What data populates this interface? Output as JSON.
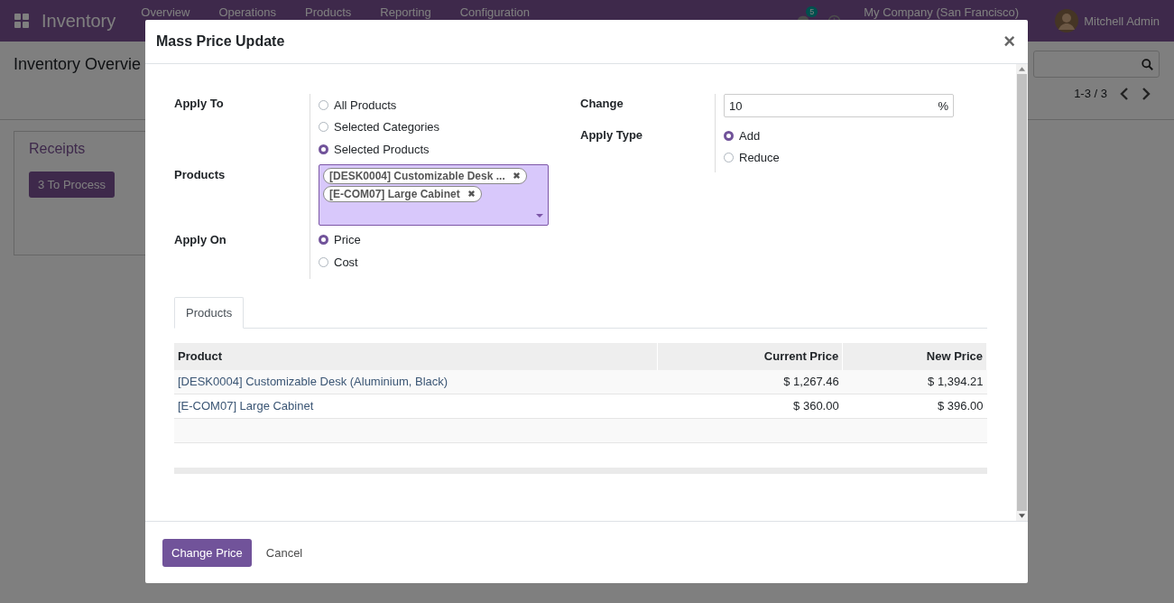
{
  "navbar": {
    "app_title": "Inventory",
    "menu": [
      "Overview",
      "Operations",
      "Products",
      "Reporting",
      "Configuration"
    ],
    "message_count": "5",
    "company": "My Company (San Francisco)",
    "user": "Mitchell Admin"
  },
  "control_panel": {
    "title": "Inventory Overvie",
    "pager": "1-3 / 3"
  },
  "cards": [
    {
      "title": "Receipts",
      "button": "3 To Process"
    }
  ],
  "dialog": {
    "title": "Mass Price Update",
    "close": "×",
    "apply_to": {
      "label": "Apply To",
      "options": [
        {
          "label": "All Products",
          "selected": false
        },
        {
          "label": "Selected Categories",
          "selected": false
        },
        {
          "label": "Selected Products",
          "selected": true
        }
      ]
    },
    "products_field": {
      "label": "Products",
      "tags": [
        "[DESK0004] Customizable Desk ...",
        "[E-COM07] Large Cabinet"
      ]
    },
    "apply_on": {
      "label": "Apply On",
      "options": [
        {
          "label": "Price",
          "selected": true
        },
        {
          "label": "Cost",
          "selected": false
        }
      ]
    },
    "change": {
      "label": "Change",
      "value": "10",
      "unit": "%"
    },
    "apply_type": {
      "label": "Apply Type",
      "options": [
        {
          "label": "Add",
          "selected": true
        },
        {
          "label": "Reduce",
          "selected": false
        }
      ]
    },
    "tabs": [
      {
        "label": "Products",
        "selected": true
      }
    ],
    "table": {
      "columns": [
        "Product",
        "Current Price",
        "New Price"
      ],
      "rows": [
        [
          "[DESK0004] Customizable Desk (Aluminium, Black)",
          "$ 1,267.46",
          "$ 1,394.21"
        ],
        [
          "[E-COM07] Large Cabinet",
          "$ 360.00",
          "$ 396.00"
        ]
      ]
    },
    "buttons": [
      {
        "label": "Change Price",
        "kind": "primary"
      },
      {
        "label": "Cancel",
        "kind": "link"
      }
    ]
  }
}
